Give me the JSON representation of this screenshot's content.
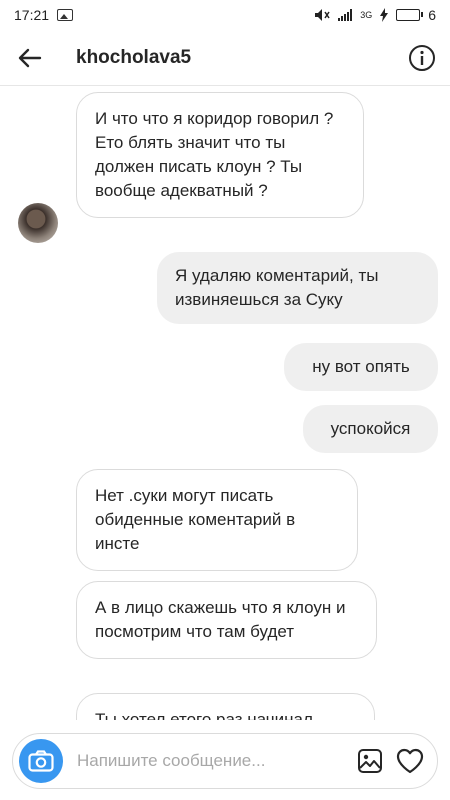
{
  "status": {
    "time": "17:21",
    "network": "3G",
    "battery": "6"
  },
  "header": {
    "username": "khocholava5",
    "back_icon": "arrow-left-icon",
    "info_icon": "info-icon"
  },
  "messages": [
    {
      "direction": "in",
      "text": "И что что я коридор говорил ? Ето блять значит что ты должен писать клоун ? Ты вообще адекватный ?"
    },
    {
      "direction": "out",
      "text": "Я удаляю коментарий, ты извиняешься за Суку"
    },
    {
      "direction": "out",
      "text": "ну вот опять"
    },
    {
      "direction": "out",
      "text": "успокойся"
    },
    {
      "direction": "in",
      "text": "Нет .суки могут писать обиденные коментарий в инсте"
    },
    {
      "direction": "in",
      "text": "А в лицо скажешь что я клоун и посмотрим что там будет"
    },
    {
      "direction": "in",
      "text": "Ты хотел етого раз начинал"
    }
  ],
  "composer": {
    "placeholder": "Напишите сообщение..."
  },
  "colors": {
    "accent": "#3897f0",
    "incoming_border": "#dbdbdb",
    "outgoing_bg": "#efefef"
  }
}
